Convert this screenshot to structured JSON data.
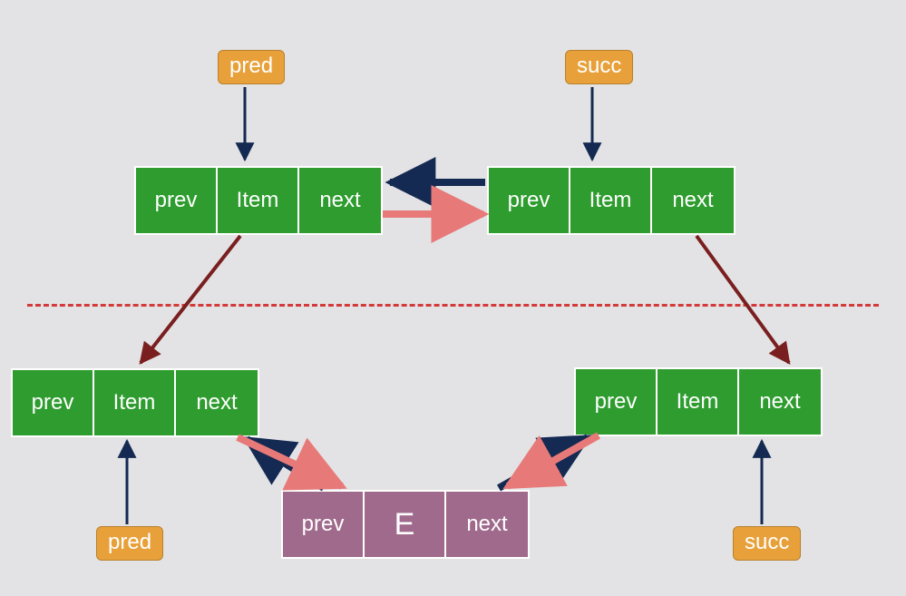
{
  "labels": {
    "pred_top": "pred",
    "succ_top": "succ",
    "pred_bottom": "pred",
    "succ_bottom": "succ"
  },
  "cells": {
    "prev": "prev",
    "item": "Item",
    "next": "next",
    "e": "E"
  },
  "nodes": {
    "topLeft": {
      "type": "green",
      "fields": [
        "prev",
        "Item",
        "next"
      ]
    },
    "topRight": {
      "type": "green",
      "fields": [
        "prev",
        "Item",
        "next"
      ]
    },
    "botLeft": {
      "type": "green",
      "fields": [
        "prev",
        "Item",
        "next"
      ]
    },
    "botRight": {
      "type": "green",
      "fields": [
        "prev",
        "Item",
        "next"
      ]
    },
    "newNode": {
      "type": "purple",
      "fields": [
        "prev",
        "E",
        "next"
      ]
    }
  },
  "colors": {
    "background": "#e3e3e5",
    "nodeGreen": "#2e9c2e",
    "nodePurple": "#a06a8c",
    "labelBox": "#e8a13a",
    "arrowDarkBlue": "#142a52",
    "arrowSalmon": "#e77a79",
    "arrowDarkRed": "#7a1f1f",
    "dividerRed": "#d33a3a"
  },
  "diagram": {
    "description": "Doubly linked list insertion: top half shows two adjacent nodes (pred, succ) linked together; bottom half shows the same two nodes with a new node E inserted between them. Dashed red line separates before/after states. Dark red diagonal arrows map the top nodes to their bottom counterparts. Dark blue arrows are 'prev' pointers, salmon arrows are 'next' pointers.",
    "arrows": [
      {
        "from": "pred_top label",
        "to": "topLeft node",
        "color": "darkBlue",
        "meaning": "label pointer"
      },
      {
        "from": "succ_top label",
        "to": "topRight node",
        "color": "darkBlue",
        "meaning": "label pointer"
      },
      {
        "from": "topRight.prev",
        "to": "topLeft",
        "color": "darkBlue",
        "meaning": "prev pointer"
      },
      {
        "from": "topLeft.next",
        "to": "topRight",
        "color": "salmon",
        "meaning": "next pointer"
      },
      {
        "from": "topLeft",
        "to": "botLeft",
        "color": "darkRed",
        "meaning": "same node before/after"
      },
      {
        "from": "topRight",
        "to": "botRight",
        "color": "darkRed",
        "meaning": "same node before/after"
      },
      {
        "from": "newNode.prev",
        "to": "botLeft",
        "color": "darkBlue",
        "meaning": "prev pointer"
      },
      {
        "from": "newNode.next",
        "to": "botRight",
        "color": "darkBlue",
        "meaning": "next pointer"
      },
      {
        "from": "botLeft.next",
        "to": "newNode",
        "color": "salmon",
        "meaning": "next pointer"
      },
      {
        "from": "botRight.prev",
        "to": "newNode",
        "color": "salmon",
        "meaning": "prev pointer (redirected)"
      },
      {
        "from": "pred_bottom label",
        "to": "botLeft node",
        "color": "darkBlue",
        "meaning": "label pointer"
      },
      {
        "from": "succ_bottom label",
        "to": "botRight node",
        "color": "darkBlue",
        "meaning": "label pointer"
      }
    ]
  }
}
